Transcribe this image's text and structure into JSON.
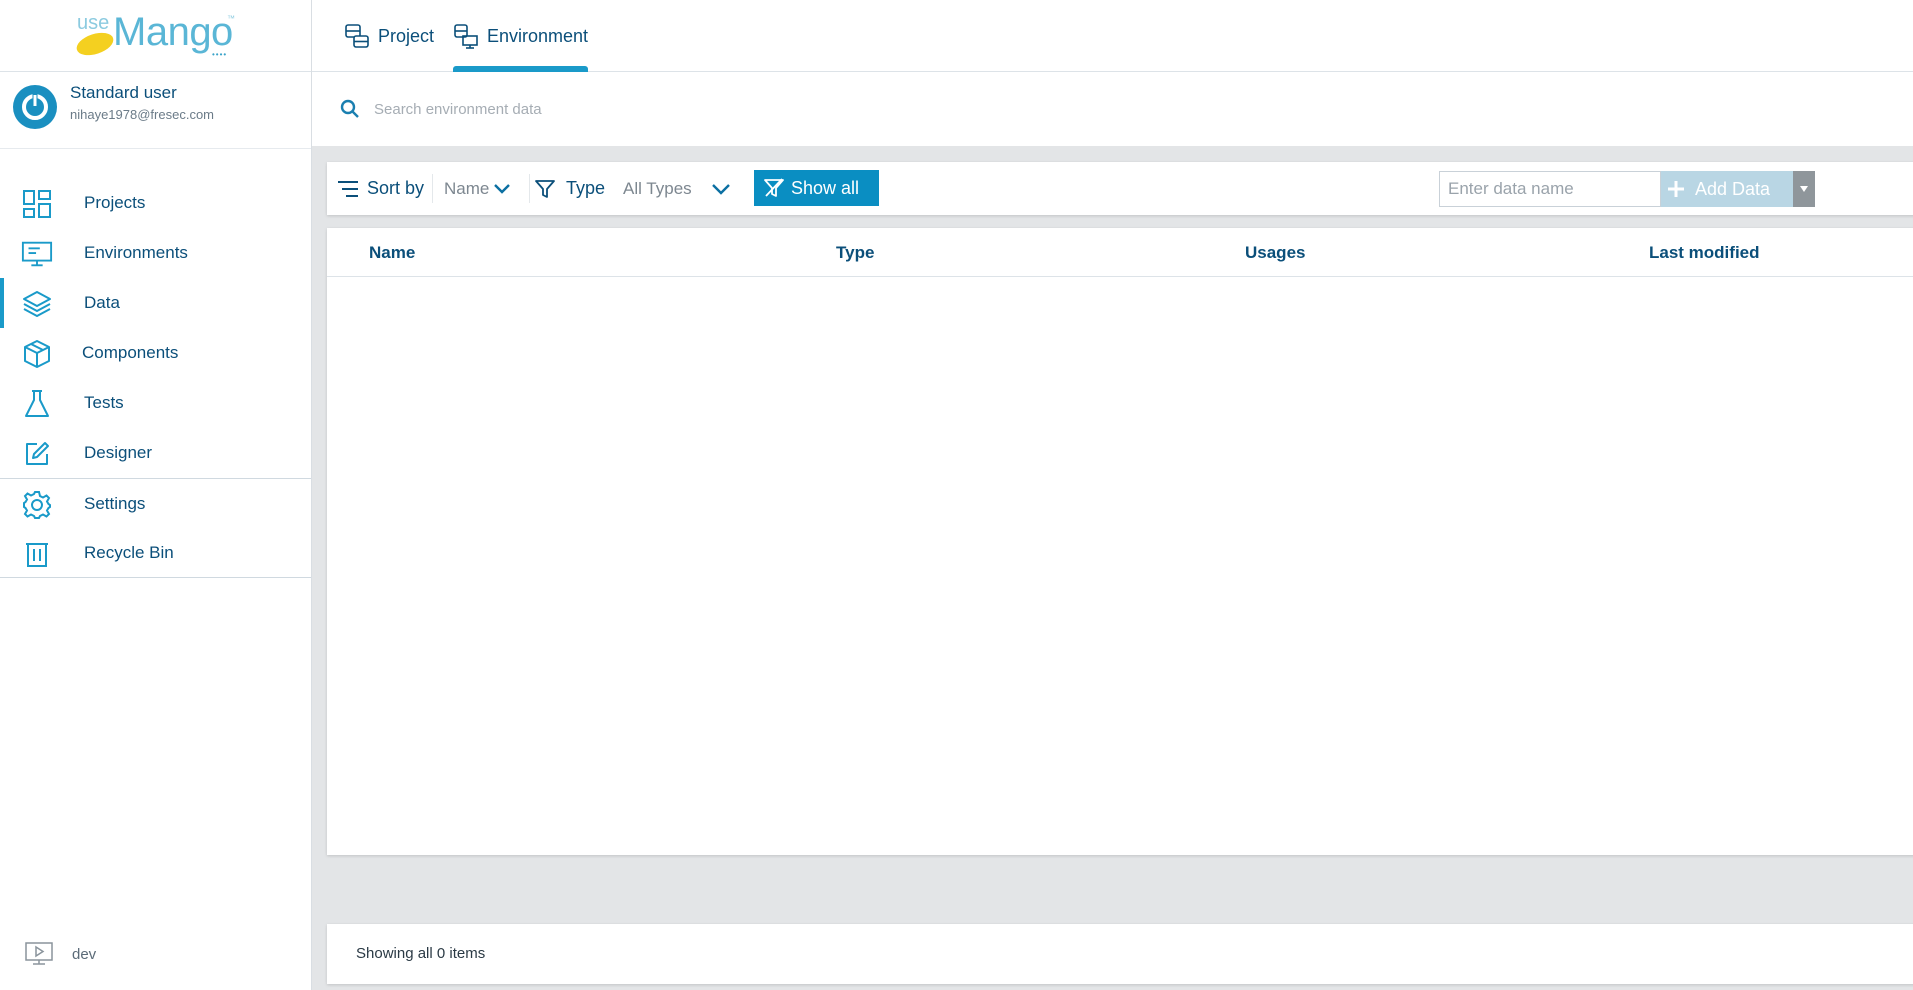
{
  "brand": {
    "logo_text_use": "use",
    "logo_text_mango": "Mango"
  },
  "user": {
    "name": "Standard user",
    "email": "nihaye1978@fresec.com"
  },
  "sidebar": {
    "items": [
      {
        "label": "Projects",
        "icon": "projects-grid-icon"
      },
      {
        "label": "Environments",
        "icon": "monitor-icon"
      },
      {
        "label": "Data",
        "icon": "layers-icon",
        "active": true
      },
      {
        "label": "Components",
        "icon": "cube-icon"
      },
      {
        "label": "Tests",
        "icon": "flask-icon"
      },
      {
        "label": "Designer",
        "icon": "edit-icon"
      },
      {
        "label": "Settings",
        "icon": "gear-icon"
      },
      {
        "label": "Recycle Bin",
        "icon": "trash-icon"
      }
    ],
    "environment_label": "dev"
  },
  "tabs": [
    {
      "label": "Project",
      "active": false
    },
    {
      "label": "Environment",
      "active": true
    }
  ],
  "search": {
    "placeholder": "Search environment data",
    "value": ""
  },
  "toolbar": {
    "sort_label": "Sort by",
    "sort_value": "Name",
    "type_label": "Type",
    "type_value": "All Types",
    "show_all_label": "Show all",
    "data_name_placeholder": "Enter data name",
    "add_data_label": "Add Data"
  },
  "table": {
    "columns": [
      "Name",
      "Type",
      "Usages",
      "Last modified"
    ],
    "rows": []
  },
  "footer": {
    "status": "Showing all 0 items"
  },
  "colors": {
    "accent": "#1a9ac9",
    "primary_text": "#0b4f7a",
    "show_all_bg": "#0a8ec2",
    "add_data_bg": "#b9d6e4"
  }
}
